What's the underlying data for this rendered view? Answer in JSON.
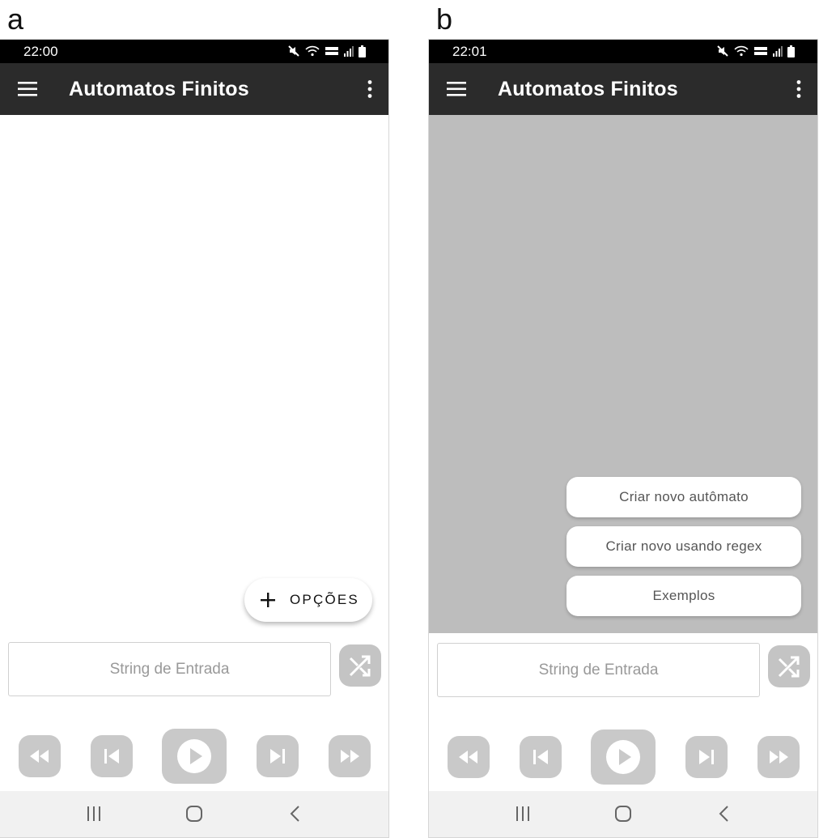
{
  "panels": [
    {
      "letter": "a",
      "status_time": "22:00",
      "app_title": "Automatos Finitos",
      "fab_label": "OPÇÕES",
      "input_placeholder": "String de Entrada"
    },
    {
      "letter": "b",
      "status_time": "22:01",
      "app_title": "Automatos Finitos",
      "menu_options": [
        "Criar novo autômato",
        "Criar novo usando regex",
        "Exemplos"
      ],
      "input_placeholder": "String de Entrada"
    }
  ],
  "icons": {
    "status": [
      "mute-icon",
      "wifi-icon",
      "volte-icon",
      "signal-icon",
      "battery-icon"
    ],
    "appbar": [
      "menu-icon",
      "more-vert-icon"
    ],
    "controls": [
      "rewind-icon",
      "skip-previous-icon",
      "play-icon",
      "skip-next-icon",
      "fast-forward-icon"
    ],
    "input": [
      "shuffle-icon"
    ],
    "nav": [
      "recent-apps-icon",
      "home-icon",
      "back-icon"
    ]
  },
  "colors": {
    "appbar": "#2b2b2b",
    "statusbar": "#000000",
    "scrim": "#bdbdbd",
    "controls": "#c9c9c9",
    "navbar": "#f1f1f1"
  }
}
